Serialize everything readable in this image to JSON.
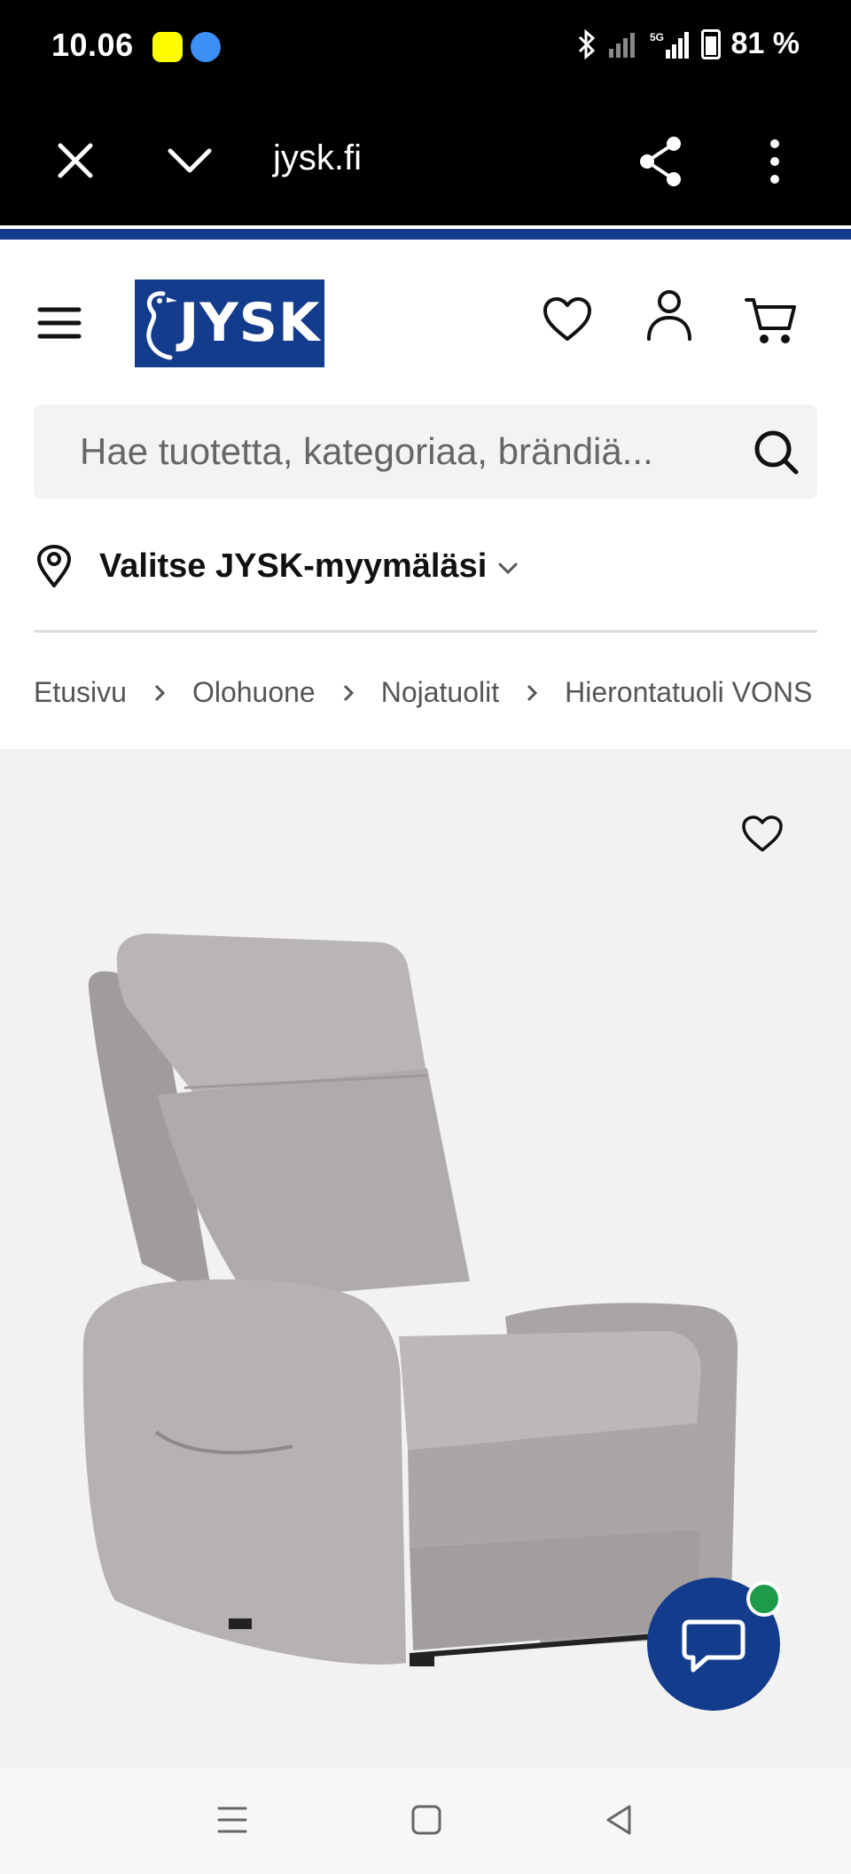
{
  "status_bar": {
    "time": "10.06",
    "battery": "81 %",
    "network": "5G"
  },
  "browser": {
    "url": "jysk.fi"
  },
  "header": {
    "logo_text": "JYSK",
    "search_placeholder": "Hae tuotetta, kategoriaa, brändiä...",
    "store_label": "Valitse JYSK-myymäläsi"
  },
  "breadcrumb": [
    "Etusivu",
    "Olohuone",
    "Nojatuolit",
    "Hierontatuoli VONS"
  ],
  "colors": {
    "brand_blue": "#143c8c",
    "online_green": "#1e9b4a",
    "chair_fabric": "#b3aeae"
  },
  "icons": {
    "status_bar": [
      "snapchat-icon",
      "weather-icon",
      "bluetooth-icon",
      "signal-icon",
      "battery-icon"
    ],
    "browser": [
      "close-icon",
      "chevron-down-icon",
      "share-icon",
      "more-vert-icon"
    ],
    "header": [
      "menu-icon",
      "heart-icon",
      "user-icon",
      "cart-icon",
      "search-icon",
      "location-pin-icon"
    ],
    "product": [
      "heart-icon",
      "chat-icon"
    ],
    "nav": [
      "recent-apps-icon",
      "home-icon",
      "back-icon"
    ]
  }
}
